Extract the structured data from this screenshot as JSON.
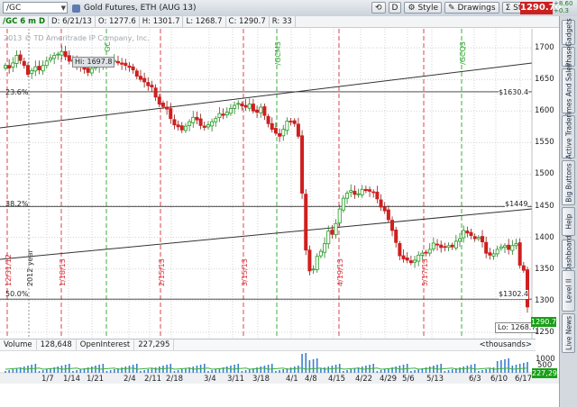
{
  "toolbar": {
    "symbol": "/GC",
    "instrument_name": "Gold Futures, ETH (AUG 13)",
    "d_label": "D",
    "style_label": "Style",
    "drawings_label": "Drawings",
    "studies_label": "Studies",
    "last_price": "1290.70",
    "change_top": "+8.60",
    "change_bottom": "+0.3"
  },
  "header_strip": {
    "fields": [
      "/GC 6 m D",
      "D: 6/21/13",
      "O: 1277.6",
      "H: 1301.7",
      "L: 1268.7",
      "C: 1290.7",
      "R: 33"
    ]
  },
  "copyright": "2013 © TD Ameritrade IP Company, Inc.",
  "chart_data": {
    "type": "candlestick",
    "title": "Gold Futures, ETH (AUG 13)",
    "x_tick_labels": [
      "1/7",
      "1/14",
      "1/21",
      "2/4",
      "2/11",
      "2/18",
      "3/4",
      "3/11",
      "3/18",
      "4/1",
      "4/8",
      "4/15",
      "4/22",
      "4/29",
      "5/6",
      "5/13",
      "6/3",
      "6/10",
      "6/17"
    ],
    "y_tick_labels": [
      "1700",
      "1650",
      "1600",
      "1550",
      "1500",
      "1450",
      "1400",
      "1350",
      "1300",
      "1250"
    ],
    "ylim": [
      1240,
      1730
    ],
    "hi_label": "Hi: 1697.8",
    "lo_label": "Lo: 1268.7",
    "last_value": "1290.7",
    "fib_levels": [
      {
        "label": "23.6%",
        "value_label": "$1630.4",
        "value": 1630.4
      },
      {
        "label": "38.2%",
        "value_label": "$1449",
        "value": 1449
      },
      {
        "label": "50.0%",
        "value_label": "$1302.4",
        "value": 1302.4
      }
    ],
    "event_labels": [
      {
        "text": "12/31/12",
        "color": "#d8323c"
      },
      {
        "text": "2012 year",
        "color": "#333333"
      },
      {
        "text": "1/18/13",
        "color": "#d8323c"
      },
      {
        "text": "GC",
        "color": "#29a629"
      },
      {
        "text": "2/15/13",
        "color": "#d8323c"
      },
      {
        "text": "3/15/13",
        "color": "#d8323c"
      },
      {
        "text": "/GCM3",
        "color": "#29a629"
      },
      {
        "text": "4/19/13",
        "color": "#d8323c"
      },
      {
        "text": "5/17/13",
        "color": "#d8323c"
      },
      {
        "text": "/GCQ3",
        "color": "#29a629"
      }
    ],
    "closes": [
      1672,
      1668,
      1676,
      1688,
      1680,
      1672,
      1658,
      1664,
      1670,
      1665,
      1672,
      1679,
      1684,
      1688,
      1690,
      1694,
      1686,
      1679,
      1681,
      1674,
      1670,
      1666,
      1661,
      1667,
      1671,
      1673,
      1676,
      1678,
      1677,
      1680,
      1676,
      1674,
      1672,
      1669,
      1665,
      1655,
      1650,
      1646,
      1640,
      1638,
      1622,
      1611,
      1607,
      1603,
      1588,
      1578,
      1575,
      1570,
      1576,
      1583,
      1590,
      1586,
      1577,
      1574,
      1578,
      1583,
      1588,
      1596,
      1593,
      1598,
      1604,
      1609,
      1612,
      1608,
      1606,
      1611,
      1600,
      1598,
      1606,
      1593,
      1580,
      1571,
      1565,
      1560,
      1571,
      1584,
      1583,
      1580,
      1560,
      1470,
      1380,
      1347,
      1350,
      1370,
      1378,
      1390,
      1410,
      1405,
      1422,
      1445,
      1462,
      1470,
      1474,
      1468,
      1469,
      1476,
      1474,
      1473,
      1471,
      1461,
      1448,
      1442,
      1428,
      1411,
      1392,
      1371,
      1366,
      1364,
      1360,
      1364,
      1372,
      1375,
      1376,
      1381,
      1391,
      1388,
      1384,
      1385,
      1387,
      1385,
      1394,
      1398,
      1411,
      1407,
      1403,
      1398,
      1400,
      1393,
      1375,
      1372,
      1374,
      1381,
      1385,
      1387,
      1381,
      1387,
      1390,
      1356,
      1348,
      1290
    ],
    "volume": {
      "label": "Volume",
      "value": "128,648"
    },
    "open_interest": {
      "label": "OpenInterest",
      "value": "227,295"
    },
    "volume_units": "<thousands>",
    "volume_ticks": [
      "1000",
      "500"
    ]
  },
  "sidebar": {
    "tabs": [
      "Gadgets",
      "Phase",
      "Times And Sales",
      "Active Trader",
      "Big Buttons",
      "Help",
      "Dashboard",
      "Level II",
      "Live News"
    ]
  },
  "colors": {
    "up_candle": "#1e9e1e",
    "down_candle": "#d01f1f",
    "fib_line": "#333333",
    "red_event": "#e04050",
    "green_event": "#39b339"
  }
}
